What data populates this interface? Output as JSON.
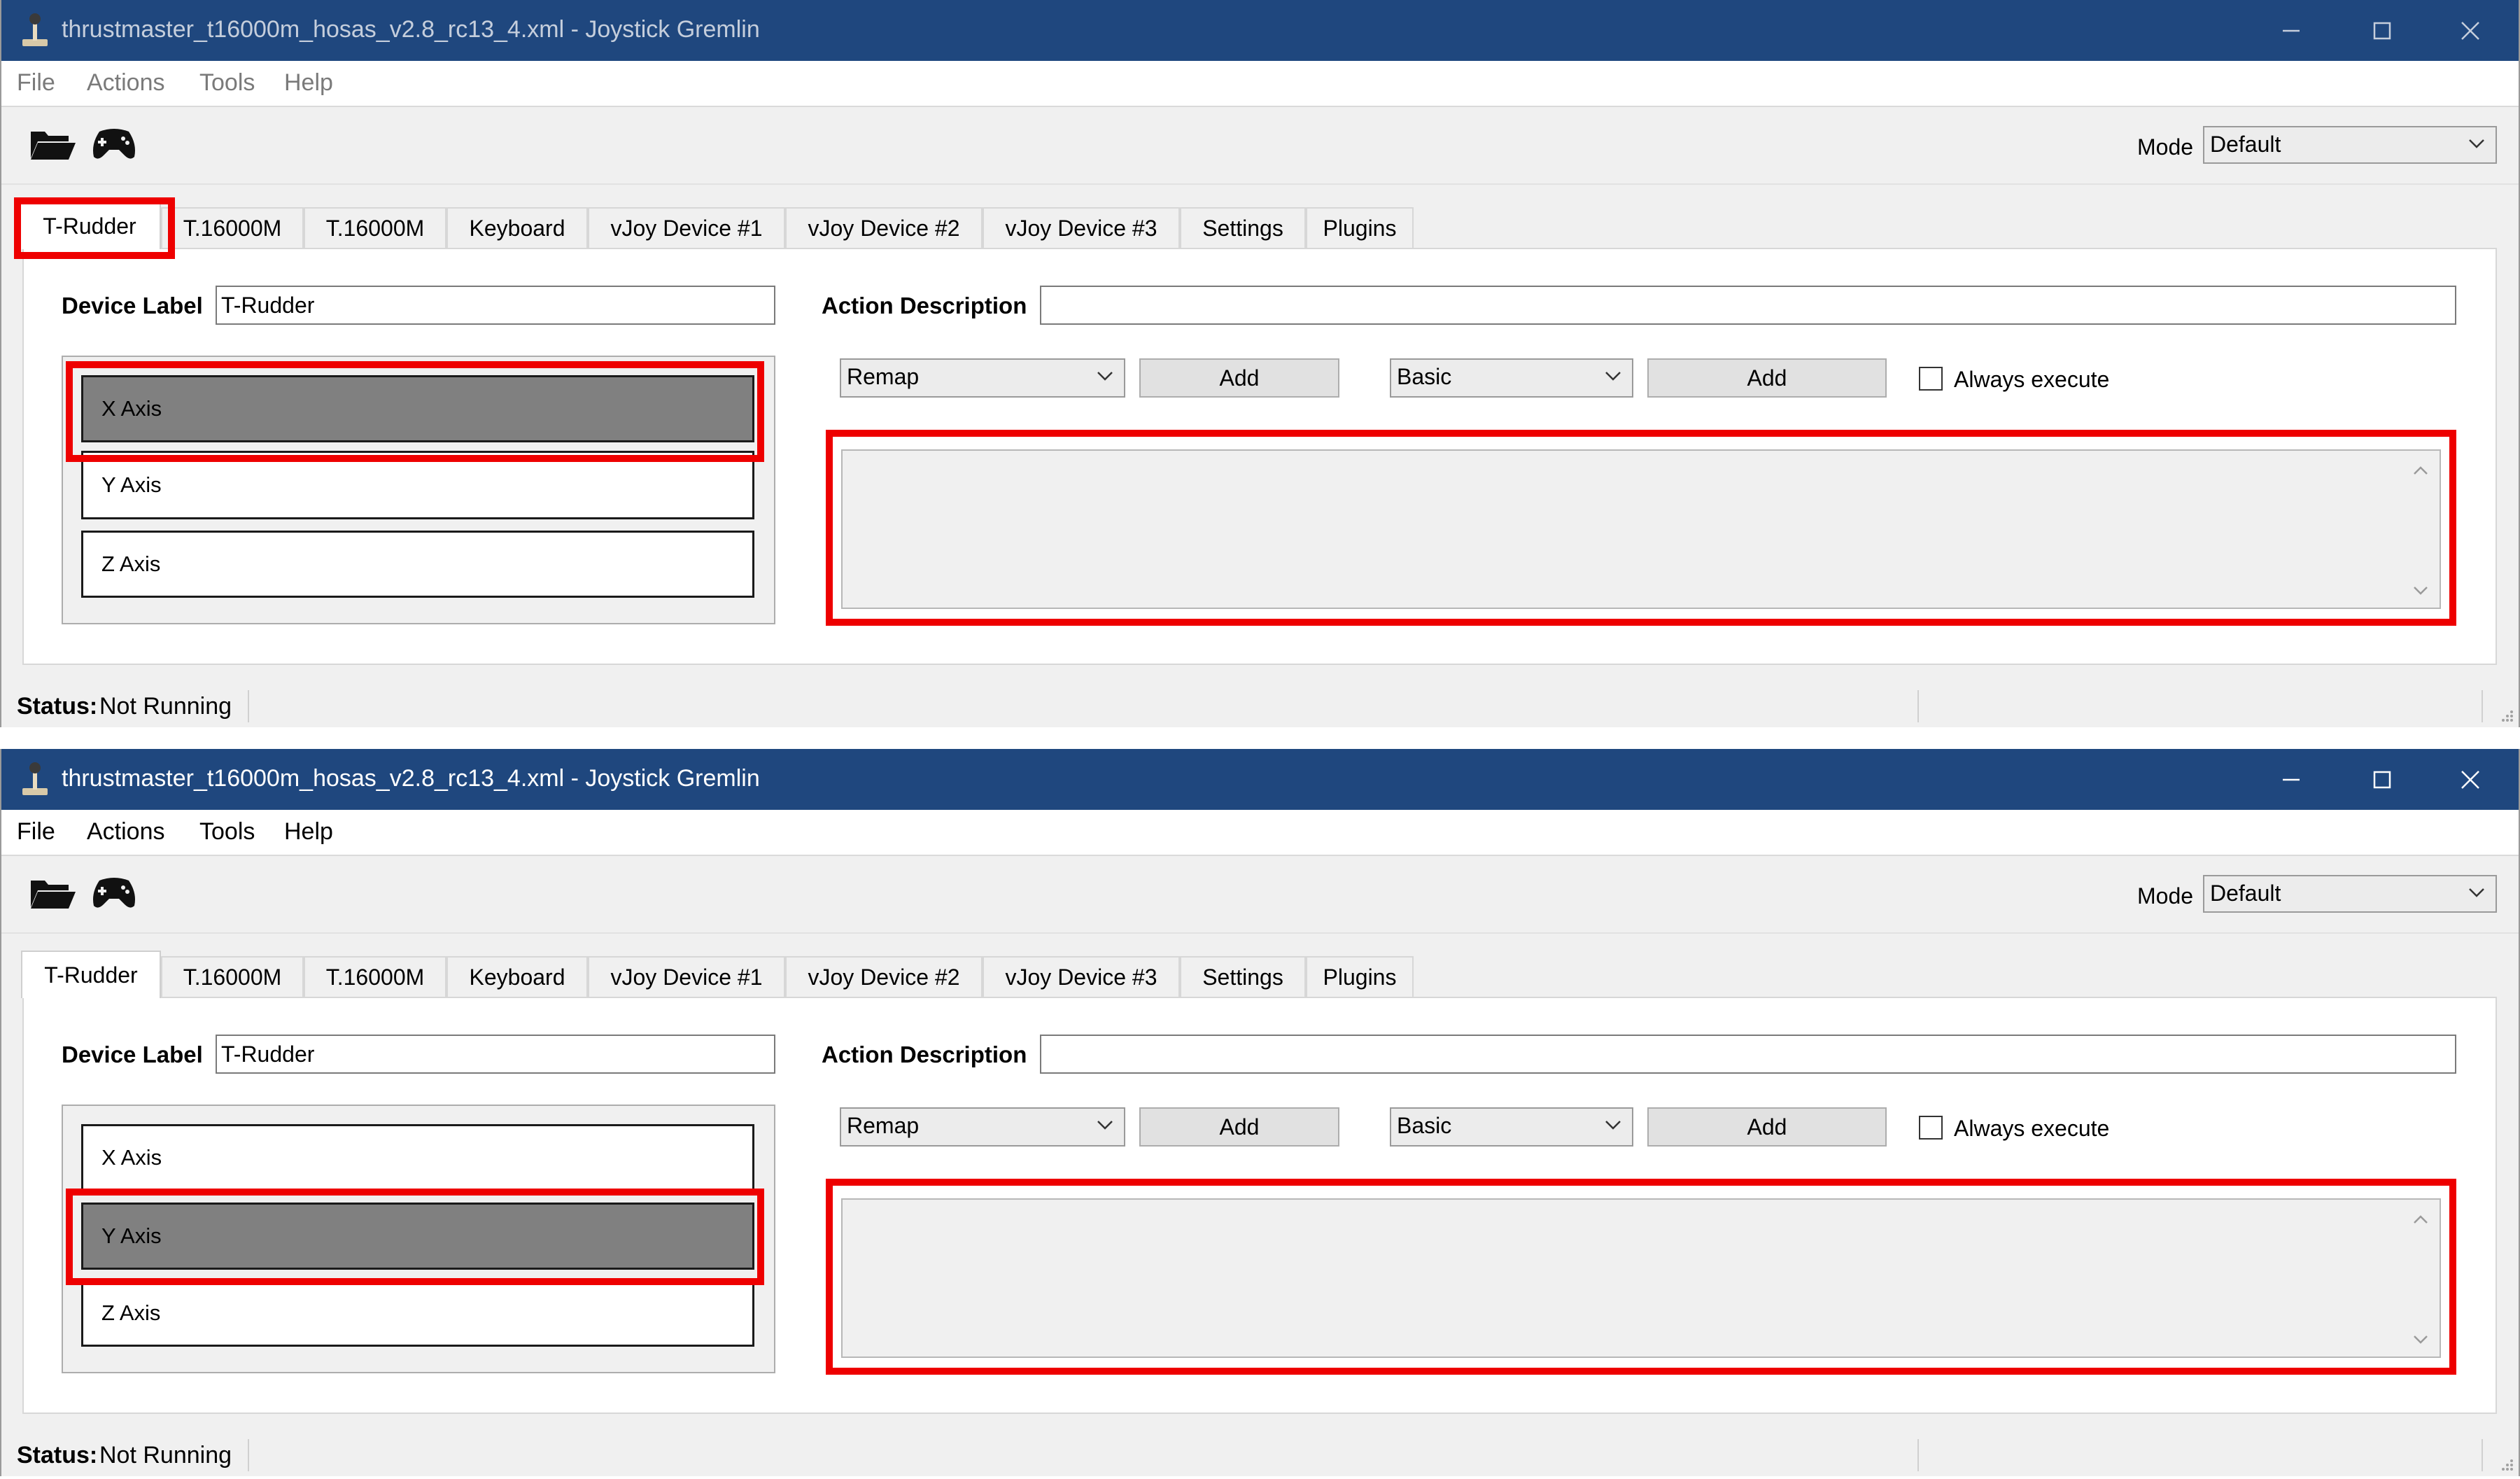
{
  "windows": [
    {
      "title": "thrustmaster_t16000m_hosas_v2.8_rc13_4.xml - Joystick Gremlin",
      "menu": [
        "File",
        "Actions",
        "Tools",
        "Help"
      ],
      "mode_label": "Mode",
      "mode_value": "Default",
      "tabs": [
        "T-Rudder",
        "T.16000M",
        "T.16000M",
        "Keyboard",
        "vJoy Device #1",
        "vJoy Device #2",
        "vJoy Device #3",
        "Settings",
        "Plugins"
      ],
      "active_tab": "T-Rudder",
      "device_label_caption": "Device Label",
      "device_label_value": "T-Rudder",
      "action_description_caption": "Action Description",
      "action_description_value": "",
      "inputs": [
        "X Axis",
        "Y Axis",
        "Z Axis"
      ],
      "selected_input": "X Axis",
      "action_type": "Remap",
      "add_action": "Add",
      "container_type": "Basic",
      "add_container": "Add",
      "always_execute": "Always execute",
      "status_label": "Status:",
      "status_value": "Not Running"
    },
    {
      "title": "thrustmaster_t16000m_hosas_v2.8_rc13_4.xml - Joystick Gremlin",
      "menu": [
        "File",
        "Actions",
        "Tools",
        "Help"
      ],
      "mode_label": "Mode",
      "mode_value": "Default",
      "tabs": [
        "T-Rudder",
        "T.16000M",
        "T.16000M",
        "Keyboard",
        "vJoy Device #1",
        "vJoy Device #2",
        "vJoy Device #3",
        "Settings",
        "Plugins"
      ],
      "active_tab": "T-Rudder",
      "device_label_caption": "Device Label",
      "device_label_value": "T-Rudder",
      "action_description_caption": "Action Description",
      "action_description_value": "",
      "inputs": [
        "X Axis",
        "Y Axis",
        "Z Axis"
      ],
      "selected_input": "Y Axis",
      "action_type": "Remap",
      "add_action": "Add",
      "container_type": "Basic",
      "add_container": "Add",
      "always_execute": "Always execute",
      "status_label": "Status:",
      "status_value": "Not Running"
    }
  ],
  "colors": {
    "titlebar": "#1f477e",
    "highlight": "#ee0000",
    "selected_input": "#808080"
  },
  "icons": [
    "joystick-app-icon",
    "folder-open-icon",
    "gamepad-icon",
    "minimize-icon",
    "maximize-icon",
    "close-icon",
    "chevron-down-icon"
  ]
}
